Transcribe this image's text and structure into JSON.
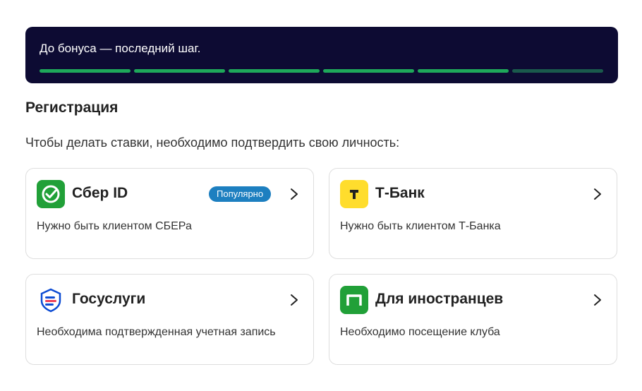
{
  "banner": {
    "text": "До бонуса — последний шаг.",
    "progress": {
      "completed_steps": 5,
      "total_steps": 6
    },
    "colors": {
      "background": "#0d0b33",
      "done": "#1ea85a",
      "pending": "#1a5a4c"
    }
  },
  "page": {
    "title": "Регистрация",
    "subtitle": "Чтобы делать ставки, необходимо подтвердить свою личность:"
  },
  "options": [
    {
      "title": "Сбер ID",
      "description": "Нужно быть клиентом СБЕРа",
      "badge": "Популярно",
      "icon": "sber-icon",
      "color": "#21a038"
    },
    {
      "title": "Т-Банк",
      "description": "Нужно быть клиентом Т-Банка",
      "icon": "tbank-icon",
      "color": "#ffdd2d"
    },
    {
      "title": "Госуслуги",
      "description": "Необходима подтвержденная учетная запись",
      "icon": "gosuslugi-icon",
      "color": "#ee3f58"
    },
    {
      "title": "Для иностранцев",
      "description": "Необходимо посещение клуба",
      "icon": "foreigners-icon",
      "color": "#21a038"
    }
  ]
}
